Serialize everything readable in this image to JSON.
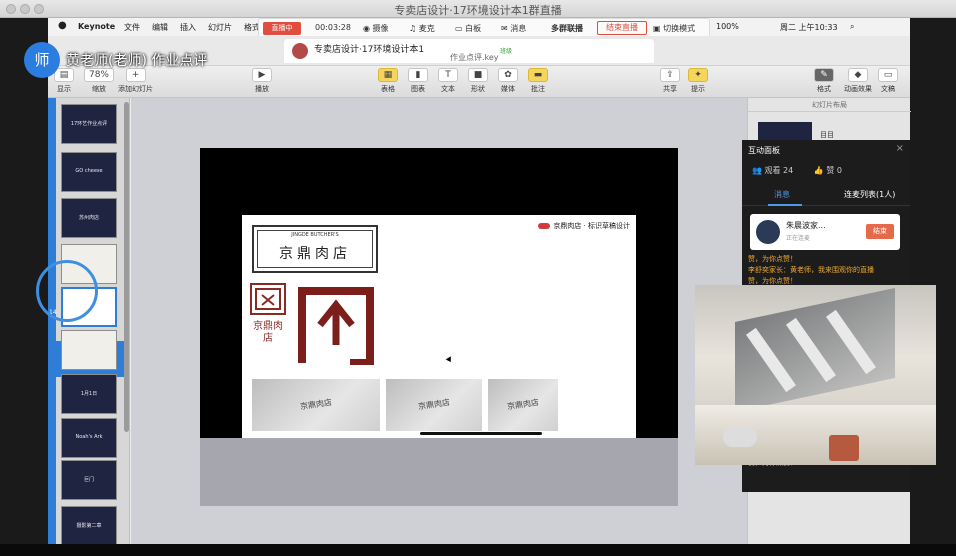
{
  "stream_window": {
    "title": "专卖店设计·17环境设计本1群直播"
  },
  "menubar": {
    "app": "Keynote",
    "items": [
      "文件",
      "编辑",
      "插入",
      "幻灯片",
      "格式"
    ],
    "battery": "100%",
    "clock": "周二 上午10:33"
  },
  "livebar": {
    "status": "直播中",
    "timer": "00:03:28",
    "items": [
      "摄像",
      "麦克",
      "白板",
      "消息"
    ],
    "multi": "多群联播",
    "end": "结束直播",
    "switch": "切换模式"
  },
  "document": {
    "tab_title": "专卖店设计·17环境设计本1",
    "tab_badge": "班级",
    "filename": "作业点评.key"
  },
  "toolbar": {
    "view": "显示",
    "zoom_value": "78%",
    "zoom": "缩放",
    "add_slide": "添加幻灯片",
    "play": "播放",
    "table": "表格",
    "chart": "图表",
    "text": "文本",
    "shape": "形状",
    "media": "媒体",
    "comment": "批注",
    "share": "共享",
    "tips": "提示",
    "format": "格式",
    "animate": "动画效果",
    "document": "文稿"
  },
  "navigator": {
    "slides": [
      {
        "num": "",
        "label": "17环艺作业点评"
      },
      {
        "num": "",
        "label": "GO cheese"
      },
      {
        "num": "",
        "label": "苏州肉店"
      },
      {
        "num": "",
        "label": ""
      },
      {
        "num": "14",
        "label": ""
      },
      {
        "num": "",
        "label": ""
      },
      {
        "num": "",
        "label": "1月1日"
      },
      {
        "num": "",
        "label": "Noah's Ark"
      },
      {
        "num": "",
        "label": "巨门"
      },
      {
        "num": "",
        "label": "摄影第二章"
      }
    ]
  },
  "slide": {
    "header": "京鼎肉店 · 标识草稿设计",
    "logo_en": "JINGDE BUTCHER'S",
    "logo_cn": "京鼎肉店",
    "stamp_cn": "京鼎肉店",
    "photo_labels": [
      "京鼎肉店",
      "京鼎肉店",
      "京鼎肉店"
    ]
  },
  "inspector": {
    "layout_label": "幻灯片布局",
    "first_item": "目目"
  },
  "panel": {
    "title": "互动面板",
    "viewers": "观看 24",
    "likes": "赞 0",
    "tab_messages": "消息",
    "tab_connect": "连麦列表(1人)",
    "card_name": "朱晨波家...",
    "card_status": "正在连麦",
    "card_end": "结束",
    "messages": [
      "赞，为你点赞！",
      "李舒奕家长：黄老师，我来围观你的直播",
      "赞，为你点赞！",
      "赞，为你点赞！"
    ]
  },
  "teacher": {
    "avatar": "师",
    "name": "黄老师(老师) 作业点评"
  }
}
